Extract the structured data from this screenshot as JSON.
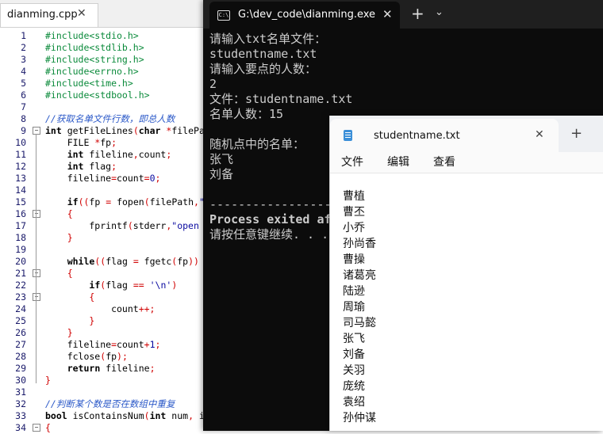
{
  "editor": {
    "tab_label": "dianming.cpp",
    "tab_close": "✕",
    "lines": [
      {
        "n": "1",
        "fold": "",
        "html": "<span class='pp'>#include&lt;stdio.h&gt;</span>"
      },
      {
        "n": "2",
        "fold": "",
        "html": "<span class='pp'>#include&lt;stdlib.h&gt;</span>"
      },
      {
        "n": "3",
        "fold": "",
        "html": "<span class='pp'>#include&lt;string.h&gt;</span>"
      },
      {
        "n": "4",
        "fold": "",
        "html": "<span class='pp'>#include&lt;errno.h&gt;</span>"
      },
      {
        "n": "5",
        "fold": "",
        "html": "<span class='pp'>#include&lt;time.h&gt;</span>"
      },
      {
        "n": "6",
        "fold": "",
        "html": "<span class='pp'>#include&lt;stdbool.h&gt;</span>"
      },
      {
        "n": "7",
        "fold": "",
        "html": ""
      },
      {
        "n": "8",
        "fold": "",
        "html": "<span class='cm'>//获取名单文件行数，即总人数</span>"
      },
      {
        "n": "9",
        "fold": "−",
        "html": "<span class='k'>int</span> <span class='fn'>getFileLines</span><span class='op'>(</span><span class='k'>char</span> <span class='op'>*</span>filePa"
      },
      {
        "n": "10",
        "fold": "",
        "html": "    FILE <span class='op'>*</span>fp<span class='op'>;</span>"
      },
      {
        "n": "11",
        "fold": "",
        "html": "    <span class='k'>int</span> fileline<span class='op'>,</span>count<span class='op'>;</span>"
      },
      {
        "n": "12",
        "fold": "",
        "html": "    <span class='k'>int</span> flag<span class='op'>;</span>"
      },
      {
        "n": "13",
        "fold": "",
        "html": "    fileline<span class='op'>=</span>count<span class='op'>=</span><span class='st'>0</span><span class='op'>;</span>"
      },
      {
        "n": "14",
        "fold": "",
        "html": ""
      },
      {
        "n": "15",
        "fold": "",
        "html": "    <span class='k'>if</span><span class='op'>((</span>fp <span class='op'>=</span> fopen<span class='op'>(</span>filePath<span class='op'>,</span><span class='st'>\"</span>"
      },
      {
        "n": "16",
        "fold": "−",
        "html": "    <span class='op'>{</span>"
      },
      {
        "n": "17",
        "fold": "",
        "html": "        fprintf<span class='op'>(</span>stderr<span class='op'>,</span><span class='st'>\"open</span>"
      },
      {
        "n": "18",
        "fold": "",
        "html": "    <span class='op'>}</span>"
      },
      {
        "n": "19",
        "fold": "",
        "html": ""
      },
      {
        "n": "20",
        "fold": "",
        "html": "    <span class='k'>while</span><span class='op'>((</span>flag <span class='op'>=</span> fgetc<span class='op'>(</span>fp<span class='op'>))</span>"
      },
      {
        "n": "21",
        "fold": "−",
        "html": "    <span class='op'>{</span>"
      },
      {
        "n": "22",
        "fold": "",
        "html": "        <span class='k'>if</span><span class='op'>(</span>flag <span class='op'>==</span> <span class='st'>'\\n'</span><span class='op'>)</span>"
      },
      {
        "n": "23",
        "fold": "−",
        "html": "        <span class='op'>{</span>"
      },
      {
        "n": "24",
        "fold": "",
        "html": "            count<span class='op'>++;</span>"
      },
      {
        "n": "25",
        "fold": "",
        "html": "        <span class='op'>}</span>"
      },
      {
        "n": "26",
        "fold": "",
        "html": "    <span class='op'>}</span>"
      },
      {
        "n": "27",
        "fold": "",
        "html": "    fileline<span class='op'>=</span>count<span class='op'>+</span><span class='st'>1</span><span class='op'>;</span>"
      },
      {
        "n": "28",
        "fold": "",
        "html": "    fclose<span class='op'>(</span>fp<span class='op'>);</span>"
      },
      {
        "n": "29",
        "fold": "",
        "html": "    <span class='k'>return</span> fileline<span class='op'>;</span>"
      },
      {
        "n": "30",
        "fold": "",
        "html": "<span class='op'>}</span>"
      },
      {
        "n": "31",
        "fold": "",
        "html": ""
      },
      {
        "n": "32",
        "fold": "",
        "html": "<span class='cm'>//判断某个数是否在数组中重复</span>"
      },
      {
        "n": "33",
        "fold": "",
        "html": "<span class='k'>bool</span> isContainsNum<span class='op'>(</span><span class='k'>int</span> num<span class='op'>,</span> i"
      },
      {
        "n": "34",
        "fold": "−",
        "html": "<span class='op'>{</span>"
      }
    ]
  },
  "terminal": {
    "title": "G:\\dev_code\\dianming.exe",
    "icon_text": "C:\\",
    "close": "✕",
    "new_tab": "+",
    "dropdown": "⌄",
    "lines": [
      {
        "text": "请输入txt名单文件：",
        "bold": false
      },
      {
        "text": "studentname.txt",
        "bold": false
      },
      {
        "text": "请输入要点的人数：",
        "bold": false
      },
      {
        "text": "2",
        "bold": false
      },
      {
        "text": "文件：studentname.txt",
        "bold": false
      },
      {
        "text": "名单人数：15",
        "bold": false
      },
      {
        "text": "",
        "bold": false
      },
      {
        "text": "随机点中的名单：",
        "bold": false
      },
      {
        "text": "张飞",
        "bold": false
      },
      {
        "text": "刘备",
        "bold": false
      },
      {
        "text": "",
        "bold": false
      },
      {
        "text": "--------------------------------",
        "bold": false
      },
      {
        "text": "Process exited af",
        "bold": true
      },
      {
        "text": "请按任意键继续. . .",
        "bold": false
      }
    ]
  },
  "notepad": {
    "tab_title": "studentname.txt",
    "close": "✕",
    "new_tab": "+",
    "menus": [
      "文件",
      "编辑",
      "查看"
    ],
    "lines": [
      "曹植",
      "曹丕",
      "小乔",
      "孙尚香",
      "曹操",
      "诸葛亮",
      "陆逊",
      "周瑜",
      "司马懿",
      "张飞",
      "刘备",
      "关羽",
      "庞统",
      "袁绍",
      "孙仲谋"
    ]
  }
}
